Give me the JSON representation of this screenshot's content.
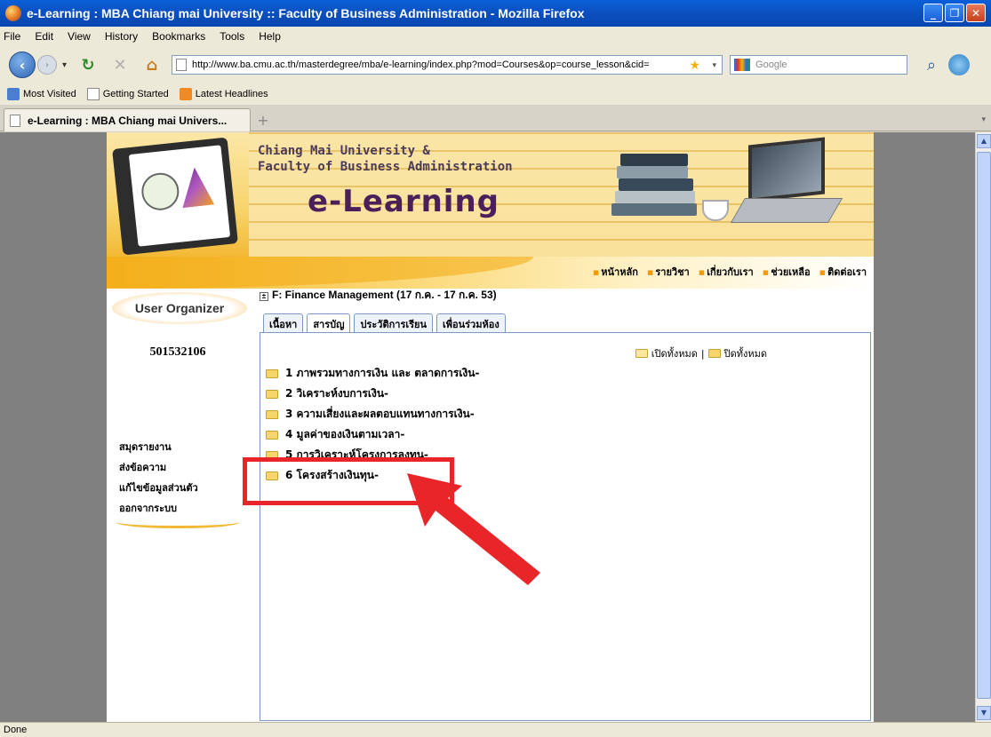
{
  "window": {
    "title": "e-Learning : MBA Chiang mai University :: Faculty of Business Administration - Mozilla Firefox"
  },
  "menu": [
    "File",
    "Edit",
    "View",
    "History",
    "Bookmarks",
    "Tools",
    "Help"
  ],
  "nav": {
    "url": "http://www.ba.cmu.ac.th/masterdegree/mba/e-learning/index.php?mod=Courses&op=course_lesson&cid=",
    "search_placeholder": "Google"
  },
  "bookmarks": [
    "Most Visited",
    "Getting Started",
    "Latest Headlines"
  ],
  "tab": {
    "label": "e-Learning : MBA Chiang mai Univers..."
  },
  "site": {
    "header_line1": "Chiang Mai University &",
    "header_line2": "Faculty of Business Administration",
    "elearning": "e-Learning",
    "topnav": [
      "หน้าหลัก",
      "รายวิชา",
      "เกี่ยวกับเรา",
      "ช่วยเหลือ",
      "ติดต่อเรา"
    ]
  },
  "sidebar": {
    "user_organizer": "User Organizer",
    "user_id": "501532106",
    "links": [
      "สมุดรายงาน",
      "ส่งข้อความ",
      "แก้ไขข้อมูลส่วนตัว",
      "ออกจากระบบ"
    ]
  },
  "course": {
    "title": "F: Finance Management (17 ก.ค. - 17 ก.ค. 53)",
    "tabs": [
      "เนื้อหา",
      "สารบัญ",
      "ประวัติการเรียน",
      "เพื่อนร่วมห้อง"
    ],
    "expand_all": "เปิดทั้งหมด",
    "separator": "|",
    "collapse_all": "ปิดทั้งหมด",
    "lessons": [
      "1 ภาพรวมทางการเงิน และ ตลาดการเงิน-",
      "2 วิเคราะห์งบการเงิน-",
      "3 ความเสี่ยงและผลตอบแทนทางการเงิน-",
      "4 มูลค่าของเงินตามเวลา-",
      "5 การวิเคราะห์โครงการลงทุน-",
      "6 โครงสร้างเงินทุน-"
    ]
  },
  "status": "Done",
  "colors": {
    "highlight": "#e8262a",
    "titlebar": "#0b4fbf"
  }
}
